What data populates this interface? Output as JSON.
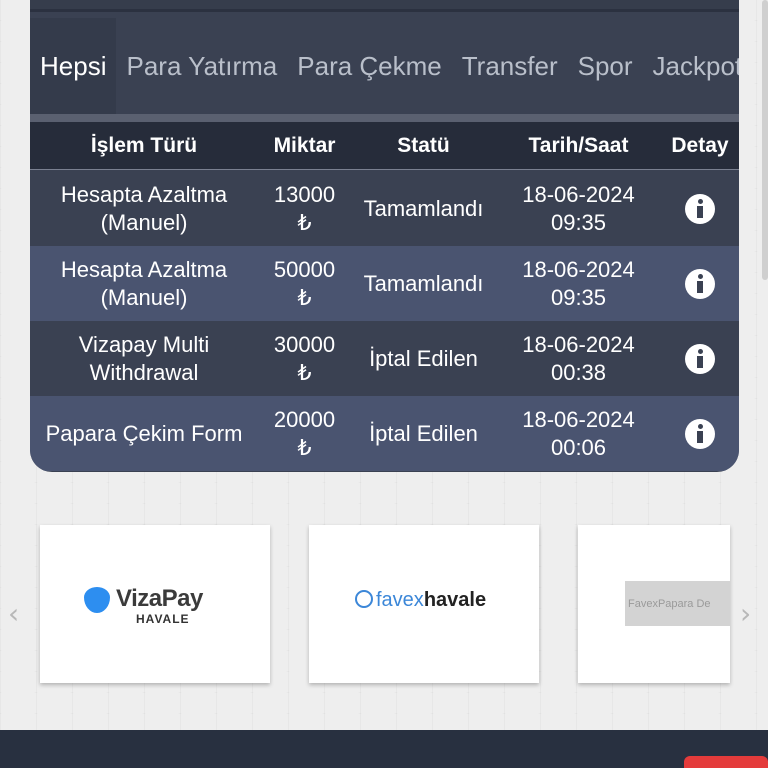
{
  "tabs": [
    {
      "label": "Hepsi",
      "active": true
    },
    {
      "label": "Para Yatırma",
      "active": false
    },
    {
      "label": "Para Çekme",
      "active": false
    },
    {
      "label": "Transfer",
      "active": false
    },
    {
      "label": "Spor",
      "active": false
    },
    {
      "label": "Jackpot",
      "active": false
    }
  ],
  "table": {
    "headers": [
      "İşlem Türü",
      "Miktar",
      "Statü",
      "Tarih/Saat",
      "Detay"
    ],
    "rows": [
      {
        "type_line1": "Hesapta Azaltma",
        "type_line2": "(Manuel)",
        "amount": "13000",
        "currency": "₺",
        "status": "Tamamlandı",
        "date": "18-06-2024",
        "time": "09:35"
      },
      {
        "type_line1": "Hesapta Azaltma",
        "type_line2": "(Manuel)",
        "amount": "50000",
        "currency": "₺",
        "status": "Tamamlandı",
        "date": "18-06-2024",
        "time": "09:35"
      },
      {
        "type_line1": "Vizapay Multi",
        "type_line2": "Withdrawal",
        "amount": "30000",
        "currency": "₺",
        "status": "İptal Edilen",
        "date": "18-06-2024",
        "time": "00:38"
      },
      {
        "type_line1": "Papara Çekim Form",
        "type_line2": "",
        "amount": "20000",
        "currency": "₺",
        "status": "İptal Edilen",
        "date": "18-06-2024",
        "time": "00:06"
      }
    ],
    "detail_icon": "info-icon"
  },
  "carousel": {
    "prev_icon": "‹",
    "next_icon": "›",
    "providers": [
      {
        "name": "VizaPay",
        "sub": "HAVALE"
      },
      {
        "name_part1": "favex",
        "name_part2": "havale"
      },
      {
        "name": "FavexPapara De"
      }
    ]
  },
  "colors": {
    "panel": "#3a4152",
    "header": "#262c3a",
    "row_alt": "#4a5470",
    "accent_red": "#e43b3b",
    "vizapay_blue": "#2d8ef0"
  }
}
